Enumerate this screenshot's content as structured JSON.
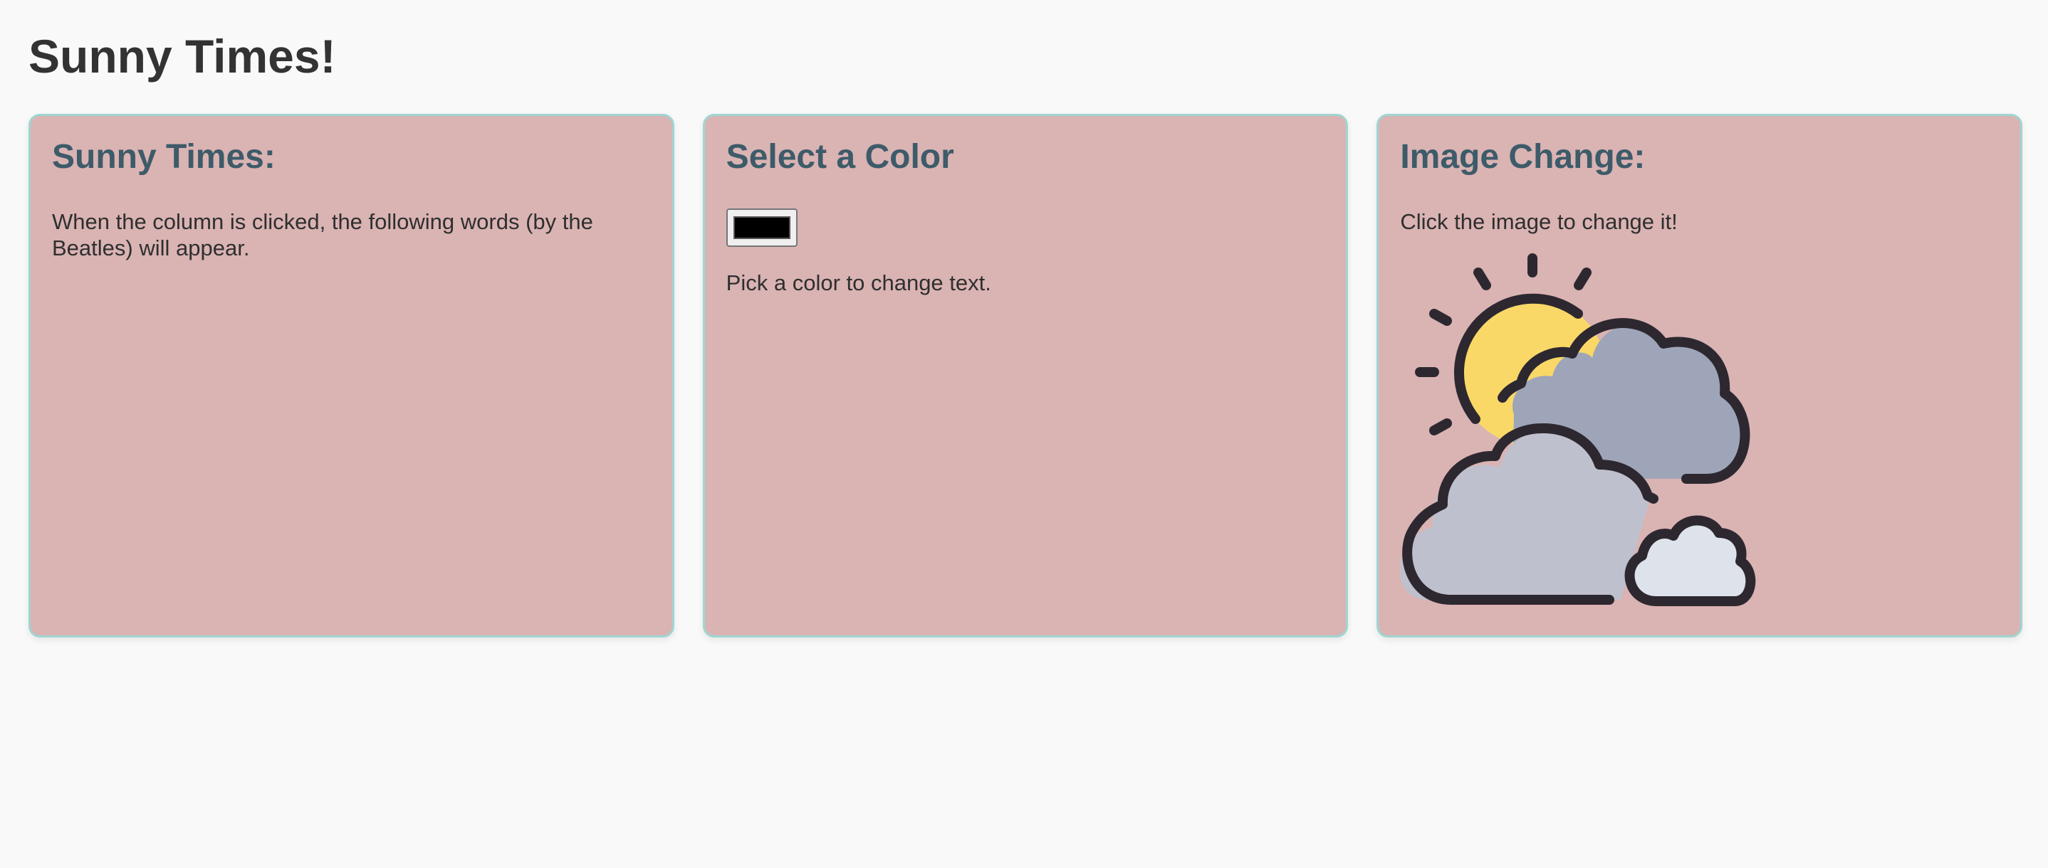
{
  "page": {
    "title": "Sunny Times!"
  },
  "columns": [
    {
      "title": "Sunny Times:",
      "text": "When the column is clicked, the following words (by the Beatles) will appear."
    },
    {
      "title": "Select a Color",
      "color_value": "#000000",
      "text": "Pick a color to change text."
    },
    {
      "title": "Image Change:",
      "text": "Click the image to change it!",
      "image_icon": "sun-behind-clouds-icon"
    }
  ],
  "colors": {
    "page_background": "#f9f9f9",
    "card_background": "#dab3b3",
    "card_border": "#9fd6d2",
    "heading": "#3d5b69",
    "sun": "#f9d867",
    "cloud_dark": "#9fa5b8",
    "cloud_mid": "#bec1cd",
    "cloud_light": "#dee2ea",
    "outline": "#2d2830"
  }
}
